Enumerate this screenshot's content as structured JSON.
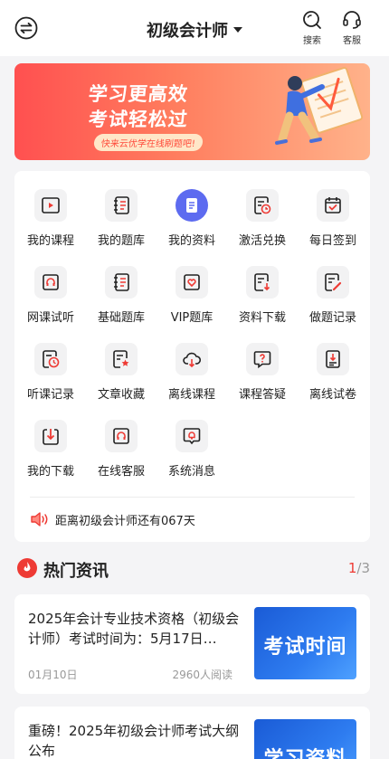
{
  "header": {
    "title": "初级会计师",
    "search_label": "搜索",
    "service_label": "客服"
  },
  "banner": {
    "line1": "学习更高效",
    "line2": "考试轻松过",
    "tagline": "快来云优学在线刷题吧!"
  },
  "menu": {
    "items": [
      {
        "label": "我的课程",
        "icon": "video-icon"
      },
      {
        "label": "我的题库",
        "icon": "question-book-icon"
      },
      {
        "label": "我的资料",
        "icon": "document-icon"
      },
      {
        "label": "激活兑换",
        "icon": "activate-icon"
      },
      {
        "label": "每日签到",
        "icon": "calendar-check-icon"
      },
      {
        "label": "网课试听",
        "icon": "headphone-icon"
      },
      {
        "label": "基础题库",
        "icon": "question-book-icon"
      },
      {
        "label": "VIP题库",
        "icon": "vip-heart-icon"
      },
      {
        "label": "资料下载",
        "icon": "file-download-icon"
      },
      {
        "label": "做题记录",
        "icon": "edit-record-icon"
      },
      {
        "label": "听课记录",
        "icon": "clock-record-icon"
      },
      {
        "label": "文章收藏",
        "icon": "star-document-icon"
      },
      {
        "label": "离线课程",
        "icon": "cloud-download-icon"
      },
      {
        "label": "课程答疑",
        "icon": "question-bubble-icon"
      },
      {
        "label": "离线试卷",
        "icon": "offline-paper-icon"
      },
      {
        "label": "我的下载",
        "icon": "download-icon"
      },
      {
        "label": "在线客服",
        "icon": "headset-icon"
      },
      {
        "label": "系统消息",
        "icon": "bell-icon"
      }
    ],
    "notice": "距离初级会计师还有067天"
  },
  "news": {
    "title": "热门资讯",
    "page_current": "1",
    "page_total": "/3",
    "items": [
      {
        "title": "2025年会计专业技术资格（初级会计师）考试时间为：5月17日…",
        "date": "01月10日",
        "reads": "2960人阅读",
        "thumb_text": "考试时间"
      },
      {
        "title": "重磅！2025年初级会计师考试大纲公布",
        "thumb_text": "学习资料"
      }
    ]
  },
  "colors": {
    "accent": "#ee3a34",
    "banner_start": "#ff5050",
    "active_icon": "#5d6bf0"
  }
}
